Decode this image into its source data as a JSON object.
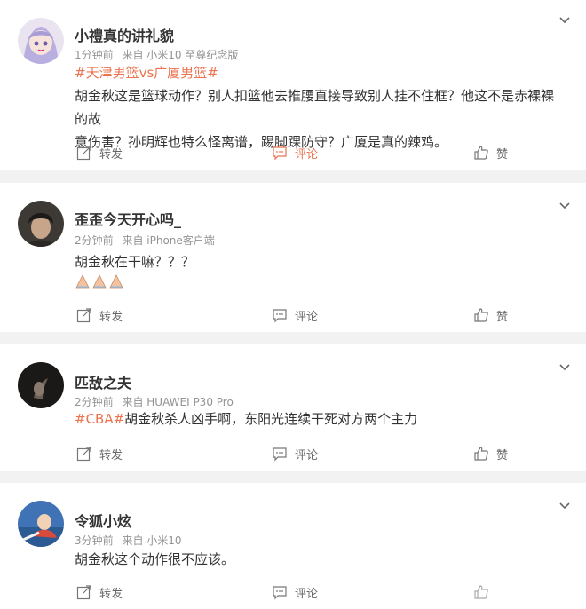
{
  "posts": [
    {
      "username": "小禮真的讲礼貌",
      "time": "1分钟前",
      "source": "来自 小米10 至尊纪念版",
      "tag": "#天津男篮vs广厦男篮#",
      "text_line1": "胡金秋这是篮球动作？别人扣篮他去推腰直接导致别人挂不住框？他这不是赤裸裸的故",
      "text_line2": "意伤害？孙明辉也特么怪离谱，踢脚踝防守？广厦是真的辣鸡。",
      "repost": "转发",
      "comment": "评论",
      "like": "赞"
    },
    {
      "username": "歪歪今天开心吗_",
      "time": "2分钟前",
      "source": "来自 iPhone客户端",
      "text": "胡金秋在干嘛？？？",
      "emoji": "🙏🙏🙏",
      "repost": "转发",
      "comment": "评论",
      "like": "赞"
    },
    {
      "username": "匹敌之夫",
      "time": "2分钟前",
      "source": "来自 HUAWEI P30 Pro",
      "tag": "#CBA#",
      "text": "胡金秋杀人凶手啊，东阳光连续干死对方两个主力",
      "repost": "转发",
      "comment": "评论",
      "like": "赞"
    },
    {
      "username": "令狐小炫",
      "time": "3分钟前",
      "source": "来自 小米10",
      "text": "胡金秋这个动作很不应该。",
      "repost": "转发",
      "comment": "评论"
    }
  ],
  "colors": {
    "accent": "#eb7350",
    "meta": "#939393",
    "background": "#f2f2f2"
  }
}
